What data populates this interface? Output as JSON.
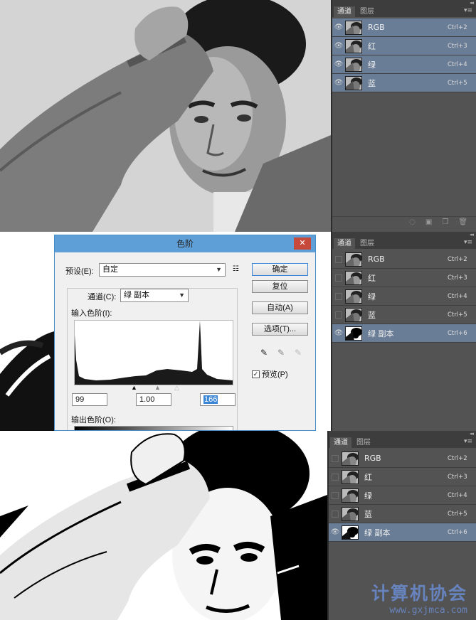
{
  "panel_common": {
    "tabs": [
      "通道",
      "图层"
    ],
    "collapse_glyph": "◂◂",
    "menu_glyph": "▾≡"
  },
  "panel1": {
    "rows": [
      {
        "label": "RGB",
        "shortcut": "Ctrl+2",
        "visible": true,
        "selected": true
      },
      {
        "label": "红",
        "shortcut": "Ctrl+3",
        "visible": true,
        "selected": true
      },
      {
        "label": "绿",
        "shortcut": "Ctrl+4",
        "visible": true,
        "selected": true
      },
      {
        "label": "蓝",
        "shortcut": "Ctrl+5",
        "visible": true,
        "selected": true
      }
    ],
    "footer_icons": [
      "dotted-circle-icon",
      "mask-icon",
      "new-channel-icon",
      "trash-icon"
    ]
  },
  "panel2": {
    "rows": [
      {
        "label": "RGB",
        "shortcut": "Ctrl+2",
        "visible": false,
        "selected": false
      },
      {
        "label": "红",
        "shortcut": "Ctrl+3",
        "visible": false,
        "selected": false
      },
      {
        "label": "绿",
        "shortcut": "Ctrl+4",
        "visible": false,
        "selected": false
      },
      {
        "label": "蓝",
        "shortcut": "Ctrl+5",
        "visible": false,
        "selected": false
      },
      {
        "label": "绿 副本",
        "shortcut": "Ctrl+6",
        "visible": true,
        "selected": true
      }
    ]
  },
  "panel3": {
    "rows": [
      {
        "label": "RGB",
        "shortcut": "Ctrl+2",
        "visible": false,
        "selected": false
      },
      {
        "label": "红",
        "shortcut": "Ctrl+3",
        "visible": false,
        "selected": false
      },
      {
        "label": "绿",
        "shortcut": "Ctrl+4",
        "visible": false,
        "selected": false
      },
      {
        "label": "蓝",
        "shortcut": "Ctrl+5",
        "visible": false,
        "selected": false
      },
      {
        "label": "绿 副本",
        "shortcut": "Ctrl+6",
        "visible": true,
        "selected": true
      }
    ]
  },
  "levels_dialog": {
    "title": "色阶",
    "close_glyph": "✕",
    "preset_label": "预设(E):",
    "preset_value": "自定",
    "channel_label": "通道(C):",
    "channel_value": "绿 副本",
    "input_levels_label": "输入色阶(I):",
    "output_levels_label": "输出色阶(O):",
    "input_black": "99",
    "input_gamma": "1.00",
    "input_white": "166",
    "buttons": {
      "ok": "确定",
      "reset": "复位",
      "auto": "自动(A)",
      "options": "选项(T)..."
    },
    "preview_label": "预览(P)",
    "preview_checked": true
  },
  "watermark": {
    "name": "计算机协会",
    "url": "www.gxjmca.com"
  },
  "colors": {
    "panel_bg": "#535353",
    "selected_row": "#6a7d96",
    "dialog_title": "#5e9fd8",
    "close_button": "#c7493c",
    "highlight": "#3b86d4"
  }
}
